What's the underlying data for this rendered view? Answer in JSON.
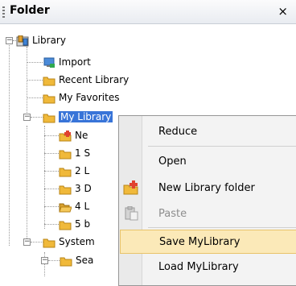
{
  "panel": {
    "title": "Folder",
    "close_glyph": "×"
  },
  "tree": {
    "root": "Library",
    "items": [
      "Import",
      "Recent Library",
      "My Favorites",
      "My Library"
    ],
    "my_library_children": [
      "Ne",
      "1 S",
      "2 L",
      "3 D",
      "4 L",
      "5 b"
    ],
    "system": "System",
    "system_child": "Sea"
  },
  "context_menu": {
    "items": [
      "Reduce",
      "Open",
      "New Library folder",
      "Paste",
      "Save MyLibrary",
      "Load MyLibrary"
    ],
    "highlighted": "Save MyLibrary",
    "disabled": [
      "Paste"
    ]
  },
  "colors": {
    "folder": "#f0b93a",
    "selection": "#3874d8",
    "highlight": "#fbe9b8"
  }
}
